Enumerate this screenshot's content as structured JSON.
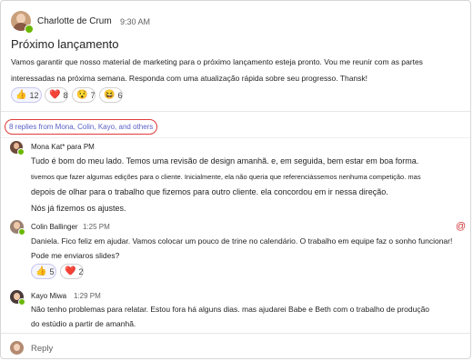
{
  "post": {
    "author": "Charlotte de Crum",
    "time": "9:30 AM",
    "title": "Próximo lançamento",
    "body": "Vamos garantir que nosso material de marketing para o próximo lançamento esteja pronto. Vou me reunir com as partes interessadas na próxima semana. Responda com uma atualização rápida sobre seu progresso. Thansk!",
    "reactions": [
      {
        "icon": "thumbs-up",
        "glyph": "👍",
        "count": "12"
      },
      {
        "icon": "heart",
        "glyph": "❤️",
        "count": "8"
      },
      {
        "icon": "surprised-face",
        "glyph": "😯",
        "count": "7"
      },
      {
        "icon": "laughing-face",
        "glyph": "😆",
        "count": "6"
      }
    ]
  },
  "thread": {
    "replies_summary": "8 replies from Mona, Colin, Kayo, and others",
    "accent_color": "#5b5fc7",
    "highlight_color": "#e03a3a"
  },
  "replies": [
    {
      "author": "Mona Kat* para PM",
      "lines": [
        "Tudo é bom do meu lado. Temos uma revisão de design amanhã. e, em seguida, bem estar em boa forma.",
        "tivemos que fazer algumas edições para o cliente. Inicialmente, ela não queria que referenciássemos nenhuma competição. mas",
        "depois de olhar para o trabalho que fizemos para outro cliente. ela concordou em ir nessa direção.",
        "Nós já fizemos os ajustes."
      ]
    },
    {
      "author": "Colin Ballinger",
      "time": "1:25 PM",
      "mention": "@",
      "lines": [
        "Daniela. Fico feliz em ajudar. Vamos colocar um pouco de trine no calendário. O trabalho em equipe faz o sonho funcionar!",
        "Pode me enviaros slides?"
      ],
      "reactions": [
        {
          "icon": "thumbs-up",
          "glyph": "👍",
          "count": "5"
        },
        {
          "icon": "heart",
          "glyph": "❤️",
          "count": "2"
        }
      ]
    },
    {
      "author": "Kayo Miwa",
      "time": "1:29 PM",
      "lines": [
        "Não tenho problemas para relatar. Estou fora há alguns dias. mas ajudarei Babe e Beth com o trabalho de produção",
        "do estúdio a partir de amanhã."
      ]
    }
  ],
  "reply_box": {
    "label": "Reply"
  }
}
